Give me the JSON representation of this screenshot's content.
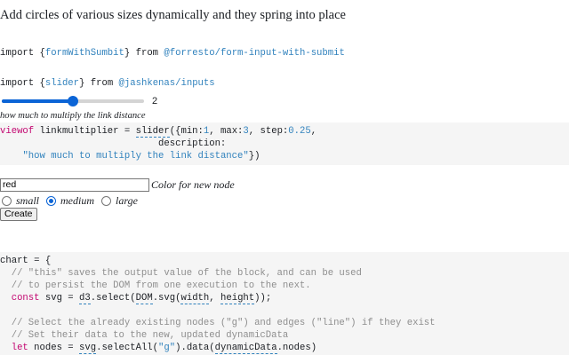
{
  "title": "Add circles of various sizes dynamically and they spring into place",
  "imports": [
    {
      "kw": "import ",
      "open": "{",
      "name": "formWithSumbit",
      "close": "}",
      "from": " from ",
      "source": "@forresto/form-input-with-submit"
    },
    {
      "kw": "import ",
      "open": "{",
      "name": "slider",
      "close": "}",
      "from": " from ",
      "source": "@jashkenas/inputs"
    }
  ],
  "slider": {
    "value": "2",
    "min": 1,
    "max": 3,
    "current": 2,
    "description": "how much to multiply the link distance"
  },
  "code1": {
    "line1": {
      "kw": "viewof",
      "name": " linkmultiplier = ",
      "fn": "slider",
      "p1": "({min:",
      "n1": "1",
      "p2": ", max:",
      "n2": "3",
      "p3": ", step:",
      "n3": "0.25",
      "p4": ","
    },
    "line2": "                            description:",
    "line3": {
      "indent": "    ",
      "str": "\"how much to multiply the link distance\"",
      "end": "})"
    }
  },
  "form": {
    "input_value": "red",
    "input_label": "Color for new node",
    "options": [
      {
        "label": "small",
        "selected": false
      },
      {
        "label": "medium",
        "selected": true
      },
      {
        "label": "large",
        "selected": false
      }
    ],
    "button_label": "Create"
  },
  "code2": {
    "l1": "chart = {",
    "l2": "  // \"this\" saves the output value of the block, and can be used",
    "l3": "  // to persist the DOM from one execution to the next.",
    "l4": {
      "indent": "  ",
      "kw": "const",
      "a": " svg = ",
      "d3": "d3",
      "b": ".select(",
      "dom": "DOM",
      "c": ".svg(",
      "w": "width",
      "d": ", ",
      "h": "height",
      "e": "));"
    },
    "l5": "  // Select the already existing nodes (\"g\") and edges (\"line\") if they exist",
    "l6": "  // Set their data to the new, updated dynamicData",
    "l7": {
      "indent": "  ",
      "kw": "let",
      "a": " nodes = ",
      "svg": "svg",
      "b": ".selectAll(",
      "s": "\"g\"",
      "c": ").data(",
      "dd": "dynamicData",
      "e": ".nodes)"
    }
  }
}
